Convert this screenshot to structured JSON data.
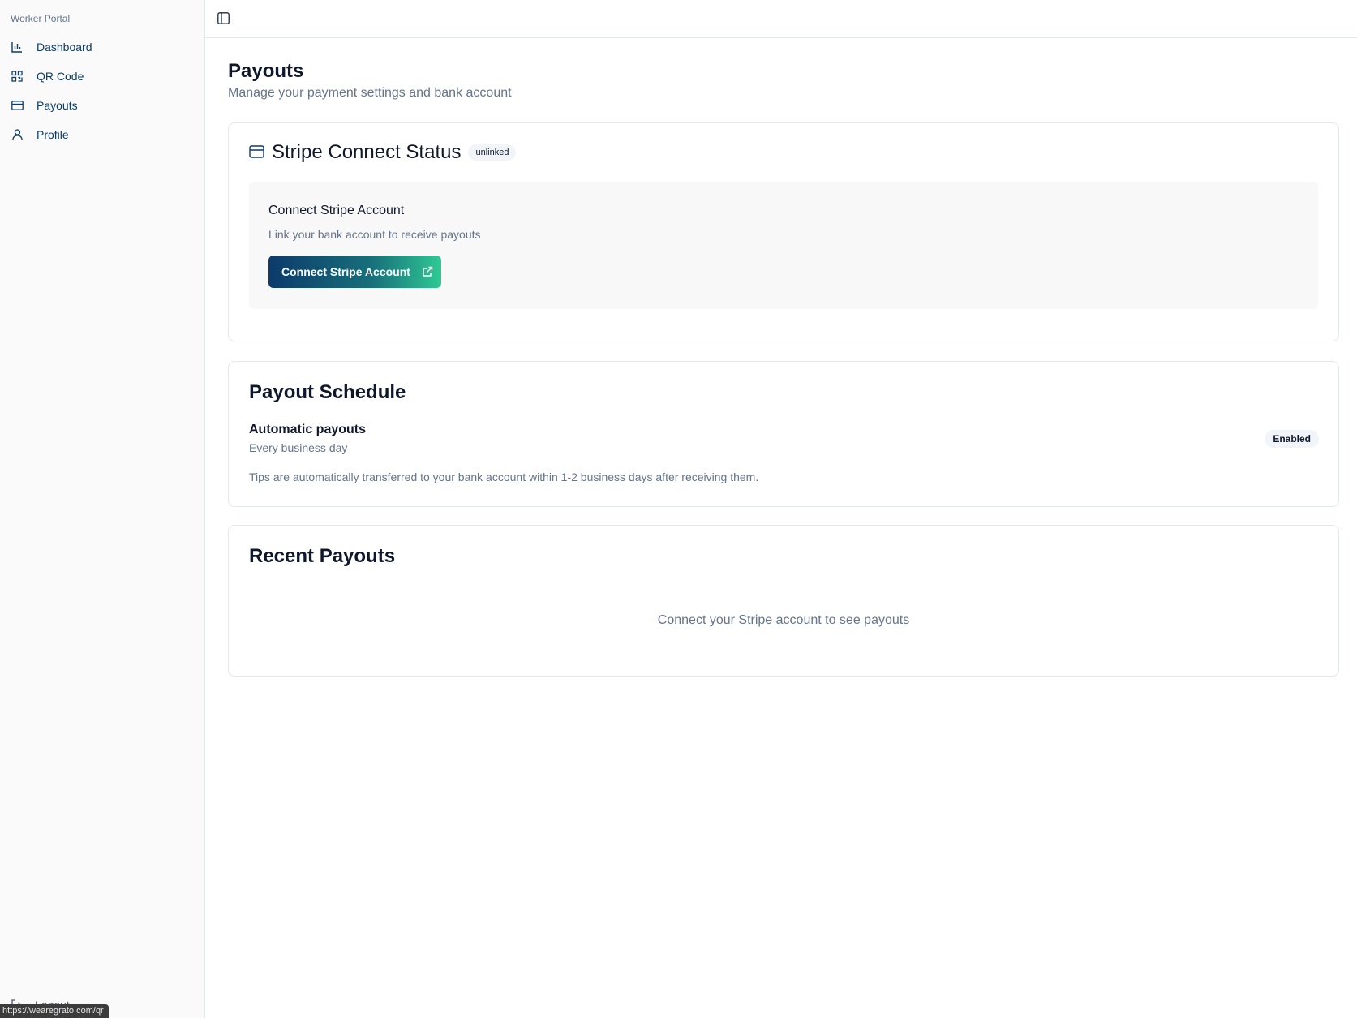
{
  "sidebar": {
    "group_label": "Worker Portal",
    "items": [
      {
        "label": "Dashboard",
        "icon": "bar-chart-icon"
      },
      {
        "label": "QR Code",
        "icon": "qr-code-icon"
      },
      {
        "label": "Payouts",
        "icon": "credit-card-icon"
      },
      {
        "label": "Profile",
        "icon": "user-icon"
      }
    ],
    "logout_label": "Logout"
  },
  "status_bar": {
    "url": "https://wearegrato.com/qr"
  },
  "page": {
    "title": "Payouts",
    "subtitle": "Manage your payment settings and bank account"
  },
  "stripe": {
    "title": "Stripe Connect Status",
    "status_badge": "unlinked",
    "panel_title": "Connect Stripe Account",
    "panel_desc": "Link your bank account to receive payouts",
    "button_label": "Connect Stripe Account"
  },
  "schedule": {
    "title": "Payout Schedule",
    "auto_title": "Automatic payouts",
    "auto_sub": "Every business day",
    "badge": "Enabled",
    "note": "Tips are automatically transferred to your bank account within 1-2 business days after receiving them."
  },
  "recent": {
    "title": "Recent Payouts",
    "empty": "Connect your Stripe account to see payouts"
  },
  "colors": {
    "brand_navy": "#0f3b66",
    "gradient_start": "#0d3a6b",
    "gradient_end": "#2fc994"
  }
}
